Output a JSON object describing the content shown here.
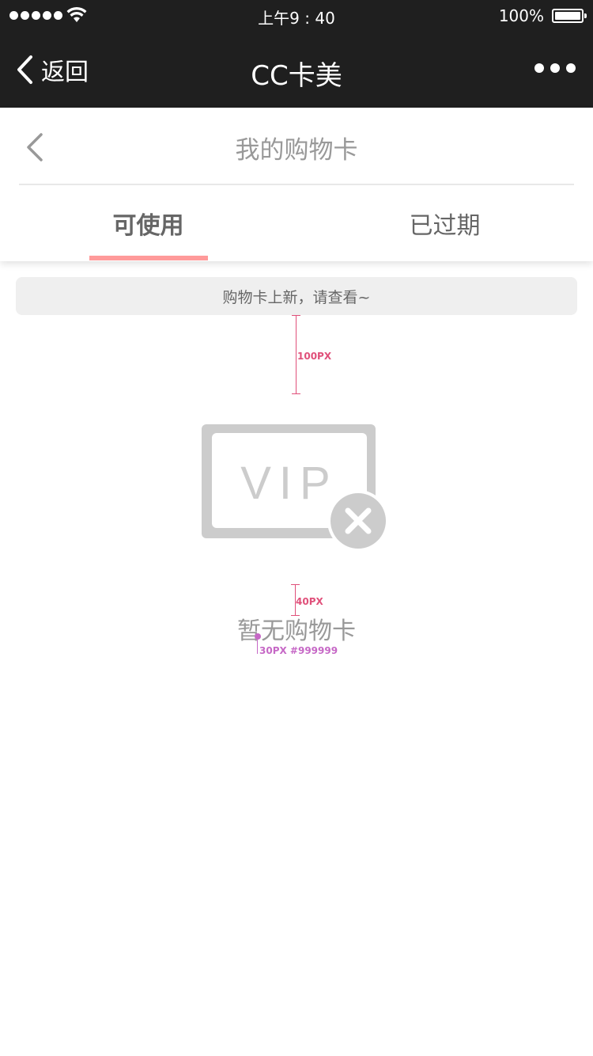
{
  "status_bar": {
    "time": "上午9 : 40",
    "battery": "100%"
  },
  "nav": {
    "back_label": "返回",
    "title": "CC卡美"
  },
  "page": {
    "title": "我的购物卡",
    "tabs": [
      {
        "label": "可使用",
        "active": true
      },
      {
        "label": "已过期",
        "active": false
      }
    ],
    "notice": "购物卡上新，请查看~"
  },
  "empty_state": {
    "icon_text": "VIP",
    "message": "暂无购物卡"
  },
  "annotations": {
    "spacing_top": "100PX",
    "spacing_text": "40PX",
    "text_spec": "30PX #999999"
  },
  "colors": {
    "bar_background": "#1f1f1f",
    "tab_indicator": "#ff9a9a",
    "annotation": "#e0507a",
    "muted_text": "#999999"
  }
}
